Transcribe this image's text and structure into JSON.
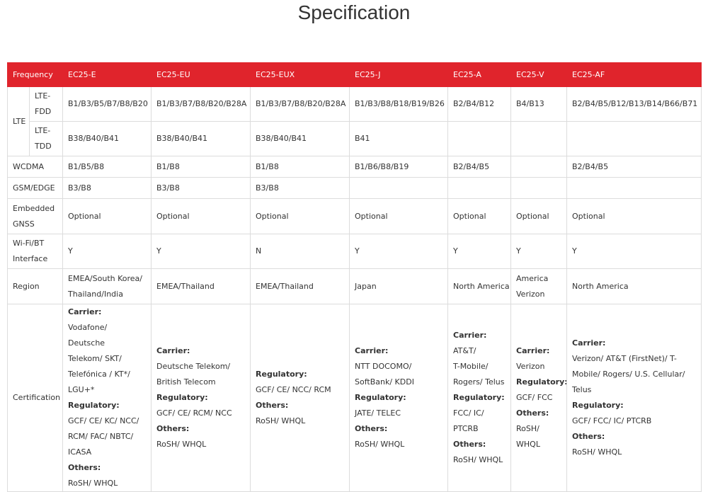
{
  "page": {
    "title": "Specification"
  },
  "table": {
    "headers": [
      "Frequency",
      "EC25-E",
      "EC25-EU",
      "EC25-EUX",
      "EC25-J",
      "EC25-A",
      "EC25-V",
      "EC25-AF"
    ],
    "lte": {
      "label": "LTE",
      "fdd": {
        "label": "LTE-\nFDD",
        "values": [
          "B1/B3/B5/B7/B8/B20",
          "B1/B3/B7/B8/B20/B28A",
          "B1/B3/B7/B8/B20/B28A",
          "B1/B3/B8/B18/B19/B26",
          "B2/B4/B12",
          "B4/B13",
          "B2/B4/B5/B12/B13/B14/B66/B71"
        ]
      },
      "tdd": {
        "label": "LTE-\nTDD",
        "values": [
          "B38/B40/B41",
          "B38/B40/B41",
          "B38/B40/B41",
          "B41",
          "",
          "",
          ""
        ]
      }
    },
    "wcdma": {
      "label": "WCDMA",
      "values": [
        "B1/B5/B8",
        "B1/B8",
        "B1/B8",
        "B1/B6/B8/B19",
        "B2/B4/B5",
        "",
        "B2/B4/B5"
      ]
    },
    "gsm": {
      "label": "GSM/EDGE",
      "values": [
        "B3/B8",
        "B3/B8",
        "B3/B8",
        "",
        "",
        "",
        ""
      ]
    },
    "gnss": {
      "label": "Embedded\nGNSS",
      "values": [
        "Optional",
        "Optional",
        "Optional",
        "Optional",
        "Optional",
        "Optional",
        "Optional"
      ]
    },
    "wifi": {
      "label": "Wi-Fi/BT\nInterface",
      "values": [
        "Y",
        "Y",
        "N",
        "Y",
        "Y",
        "Y",
        "Y"
      ]
    },
    "region": {
      "label": "Region",
      "values": [
        "EMEA/South Korea/\nThailand/India",
        "EMEA/Thailand",
        "EMEA/Thailand",
        "Japan",
        "North America",
        "America\nVerizon",
        "North America"
      ]
    },
    "certification": {
      "label": "Certification",
      "cells": [
        [
          "Carrier:",
          "Vodafone/ Deutsche",
          "Telekom/ SKT/",
          "Telefónica / KT*/",
          "LGU+*",
          "Regulatory:",
          "GCF/ CE/ KC/ NCC/",
          "RCM/ FAC/ NBTC/",
          "ICASA",
          "Others:",
          "RoSH/ WHQL"
        ],
        [
          "Carrier:",
          "Deutsche Telekom/",
          "British Telecom",
          "Regulatory:",
          "GCF/ CE/ RCM/ NCC",
          "Others:",
          "RoSH/ WHQL"
        ],
        [
          "Regulatory:",
          "GCF/ CE/ NCC/ RCM",
          "Others:",
          "RoSH/ WHQL"
        ],
        [
          "Carrier:",
          "NTT DOCOMO/",
          "SoftBank/ KDDI",
          "Regulatory:",
          "JATE/ TELEC",
          "Others:",
          "RoSH/ WHQL"
        ],
        [
          "Carrier:",
          "AT&T/",
          "T-Mobile/",
          "Rogers/ Telus",
          "Regulatory:",
          "FCC/ IC/",
          "PTCRB",
          "Others:",
          "RoSH/ WHQL"
        ],
        [
          "Carrier:",
          "Verizon",
          "Regulatory:",
          "GCF/ FCC",
          "Others:",
          "RoSH/ WHQL"
        ],
        [
          "Carrier:",
          "Verizon/ AT&T (FirstNet)/ T-",
          "Mobile/ Rogers/ U.S. Cellular/",
          "Telus",
          "Regulatory:",
          "GCF/ FCC/ IC/ PTCRB",
          "Others:",
          "RoSH/ WHQL"
        ]
      ],
      "bold_lines": [
        "Carrier:",
        "Regulatory:",
        "Others:"
      ]
    }
  }
}
